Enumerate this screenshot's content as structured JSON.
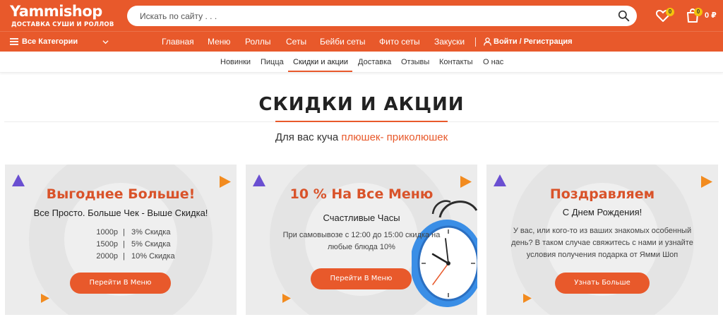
{
  "header": {
    "logo_main": "Yammishop",
    "logo_sub": "ДОСТАВКА СУШИ И РОЛЛОВ",
    "search_placeholder": "Искать по сайту . . .",
    "wishlist_count": "0",
    "cart_count": "0",
    "cart_total": "0 ₽"
  },
  "nav": {
    "categories_label": "Все Категории",
    "items": [
      "Главная",
      "Меню",
      "Роллы",
      "Сеты",
      "Бейби сеты",
      "Фито сеты",
      "Закуски"
    ],
    "login_label": "Войти / Регистрация"
  },
  "subnav": {
    "items": [
      "Новинки",
      "Пицца",
      "Скидки и акции",
      "Доставка",
      "Отзывы",
      "Контакты",
      "О нас"
    ],
    "active_index": 2
  },
  "page": {
    "title": "СКИДКИ И АКЦИИ",
    "subtitle_plain": "Для вас куча ",
    "subtitle_highlight": "плюшек- приколюшек"
  },
  "cards": [
    {
      "title": "Выгоднее Больше!",
      "subtitle": "Все Просто. Больше Чек - Выше Скидка!",
      "prices": [
        {
          "amount": "1000р",
          "discount": "3% Скидка"
        },
        {
          "amount": "1500р",
          "discount": "5% Скидка"
        },
        {
          "amount": "2000р",
          "discount": "10% Скидка"
        }
      ],
      "separator": "|",
      "button": "Перейти В Меню"
    },
    {
      "title": "10 % На Все Меню",
      "subtitle": "Счастливые Часы",
      "body": "При самовывозе с 12:00 до 15:00 скидка на любые блюда 10%",
      "button": "Перейти В Меню"
    },
    {
      "title": "Поздравляем",
      "subtitle": "С Днем Рождения!",
      "body": "У вас, или кого-то из ваших знакомых особенный день? В таком случае свяжитесь с нами и узнайте условия получения подарка от Ямми Шоп",
      "button": "Узнать Больше"
    }
  ],
  "colors": {
    "brand": "#e8592b",
    "card_title": "#d9532a",
    "badge": "#f4c20d",
    "triangle_purple": "#6a4fd1",
    "triangle_orange": "#f28b1f",
    "clock_blue": "#3a8ee6"
  },
  "icons": [
    "search-icon",
    "heart-icon",
    "bag-icon",
    "hamburger-icon",
    "chevron-down-icon",
    "user-icon",
    "clock-icon"
  ]
}
